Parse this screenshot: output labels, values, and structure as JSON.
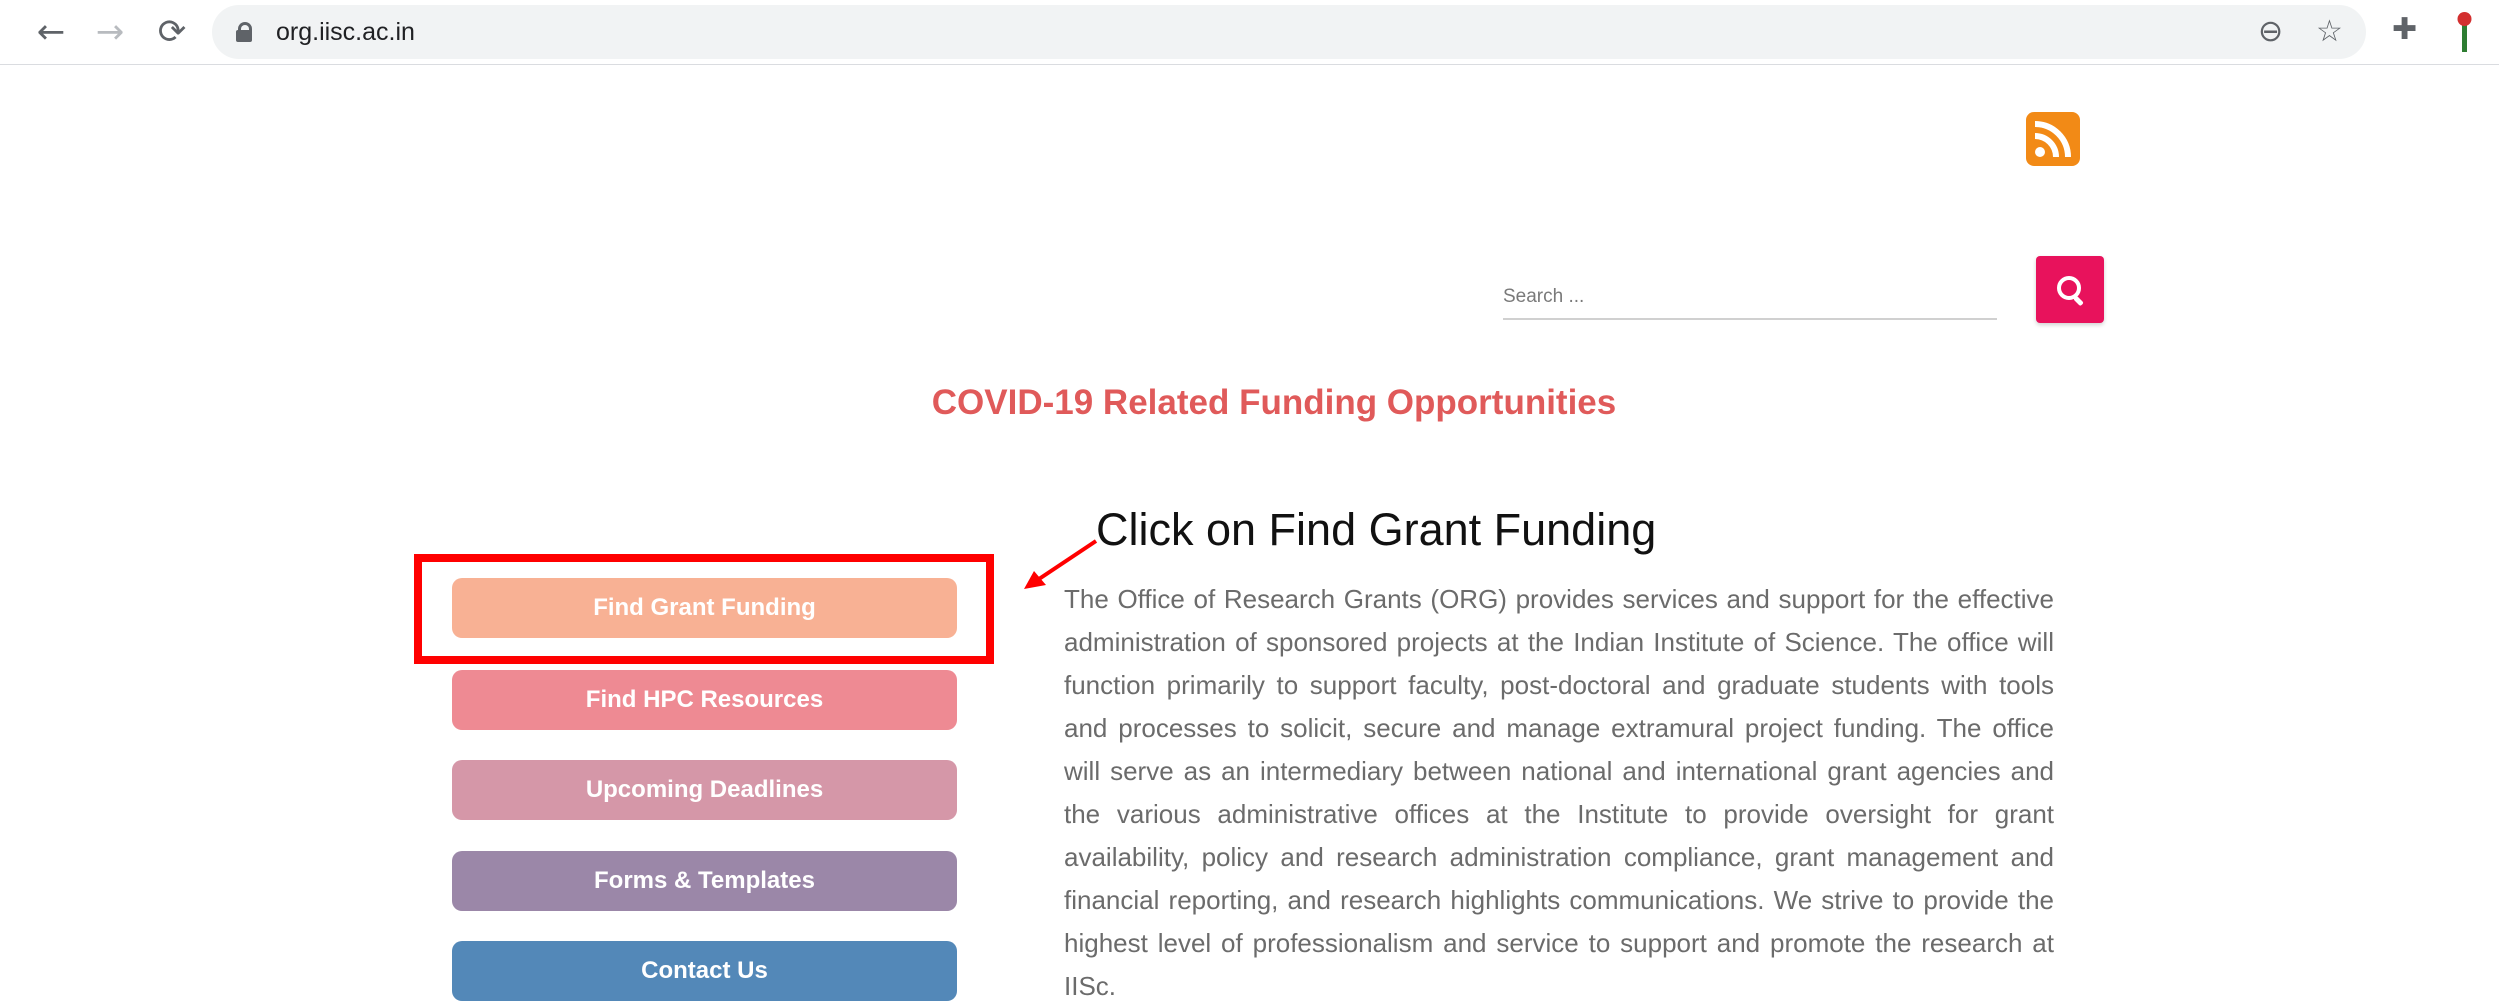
{
  "browser": {
    "url": "org.iisc.ac.in",
    "back_icon": "←",
    "forward_icon": "→",
    "reload_icon": "⟳",
    "zoom_icon": "⊖",
    "star_icon": "☆",
    "extensions_icon": "✚"
  },
  "search": {
    "placeholder": "Search ..."
  },
  "heading": "COVID-19 Related Funding Opportunities",
  "annotation": {
    "text": "Click on Find  Grant Funding",
    "color": "#ff0000"
  },
  "side_buttons": [
    {
      "label": "Find Grant Funding",
      "color": "#f8b194"
    },
    {
      "label": "Find HPC Resources",
      "color": "#ee8a93"
    },
    {
      "label": "Upcoming Deadlines",
      "color": "#d597a8"
    },
    {
      "label": "Forms & Templates",
      "color": "#9b87a8"
    },
    {
      "label": "Contact Us",
      "color": "#5388b8"
    }
  ],
  "description": "The Office of Research Grants (ORG) provides services and support for the effective administration of sponsored projects at the Indian Institute of Science. The office will function primarily to support faculty, post-doctoral and graduate students with tools and processes to solicit, secure and manage extramural project funding. The office will serve as an intermediary between national and international grant agencies and the various administrative offices at the Institute to provide oversight for grant availability, policy and research administration compliance, grant management and financial reporting, and research highlights communications. We strive to provide the highest level of professionalism and service to support and promote the research at IISc.",
  "colors": {
    "heading": "#e05a5a",
    "search_button": "#e8125c",
    "rss": "#f28a16"
  }
}
